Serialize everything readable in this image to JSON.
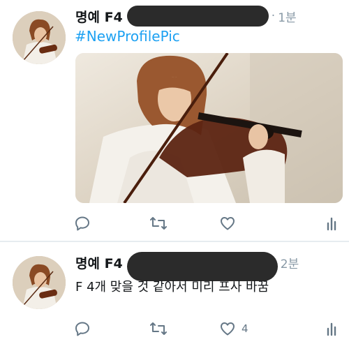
{
  "tweets": [
    {
      "name": "명예 F4",
      "time": "1분",
      "separator": "·",
      "hashtag": "#NewProfilePic",
      "text": "",
      "like_count": "",
      "has_media": true
    },
    {
      "name": "명예 F4",
      "time": "2분",
      "separator": "",
      "hashtag": "",
      "text": "F 4개 맞을 것 같아서 미리 프사 바꿈",
      "like_count": "4",
      "has_media": false
    }
  ],
  "icons": {
    "reply": "reply-icon",
    "retweet": "retweet-icon",
    "like": "heart-icon",
    "stats": "analytics-icon"
  },
  "colors": {
    "hashtag": "#1da1f2",
    "secondary_text": "#8899a6",
    "icon": "#657786",
    "divider": "#e6ecf0",
    "redaction": "#2b2b2b"
  }
}
